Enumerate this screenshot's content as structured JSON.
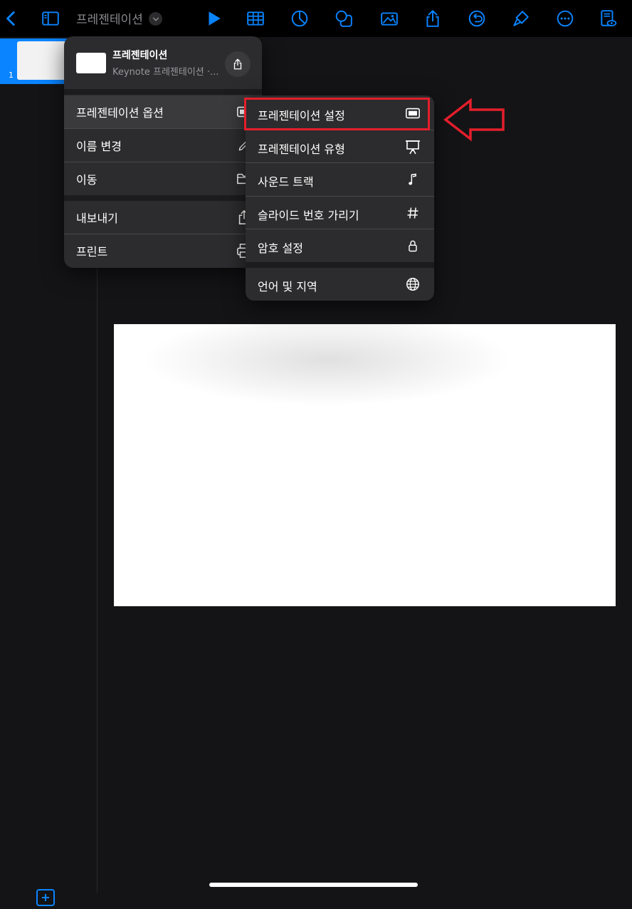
{
  "toolbar": {
    "doc_title": "프레젠테이션",
    "icons": [
      "back-icon",
      "sidebar-icon",
      "chevron-down-icon",
      "play-icon",
      "table-icon",
      "chart-icon",
      "shapes-icon",
      "media-icon",
      "share-icon",
      "undo-icon",
      "format-brush-icon",
      "more-icon",
      "reading-view-icon"
    ]
  },
  "sidebar": {
    "slide_number": "1"
  },
  "doc_menu": {
    "header": {
      "title": "프레젠테이션",
      "subtitle": "Keynote 프레젠테이션 ·..."
    },
    "items": [
      {
        "label": "프레젠테이션 옵션",
        "icon": "presentation-icon"
      },
      {
        "label": "이름 변경",
        "icon": "pencil-icon"
      },
      {
        "label": "이동",
        "icon": "folder-icon"
      },
      {
        "label": "내보내기",
        "icon": "export-icon"
      },
      {
        "label": "프린트",
        "icon": "printer-icon"
      }
    ]
  },
  "submenu": {
    "items": [
      {
        "label": "프레젠테이션 설정",
        "icon": "presentation-icon"
      },
      {
        "label": "프레젠테이션 유형",
        "icon": "projector-icon"
      },
      {
        "label": "사운드 트랙",
        "icon": "music-note-icon"
      },
      {
        "label": "슬라이드 번호 가리기",
        "icon": "hash-icon"
      },
      {
        "label": "암호 설정",
        "icon": "lock-icon"
      },
      {
        "label": "언어 및 지역",
        "icon": "globe-icon"
      }
    ]
  },
  "colors": {
    "accent": "#0a84ff",
    "annotation": "#e41e2b",
    "menu_bg": "#2c2c2e",
    "canvas_bg": "#141416"
  }
}
